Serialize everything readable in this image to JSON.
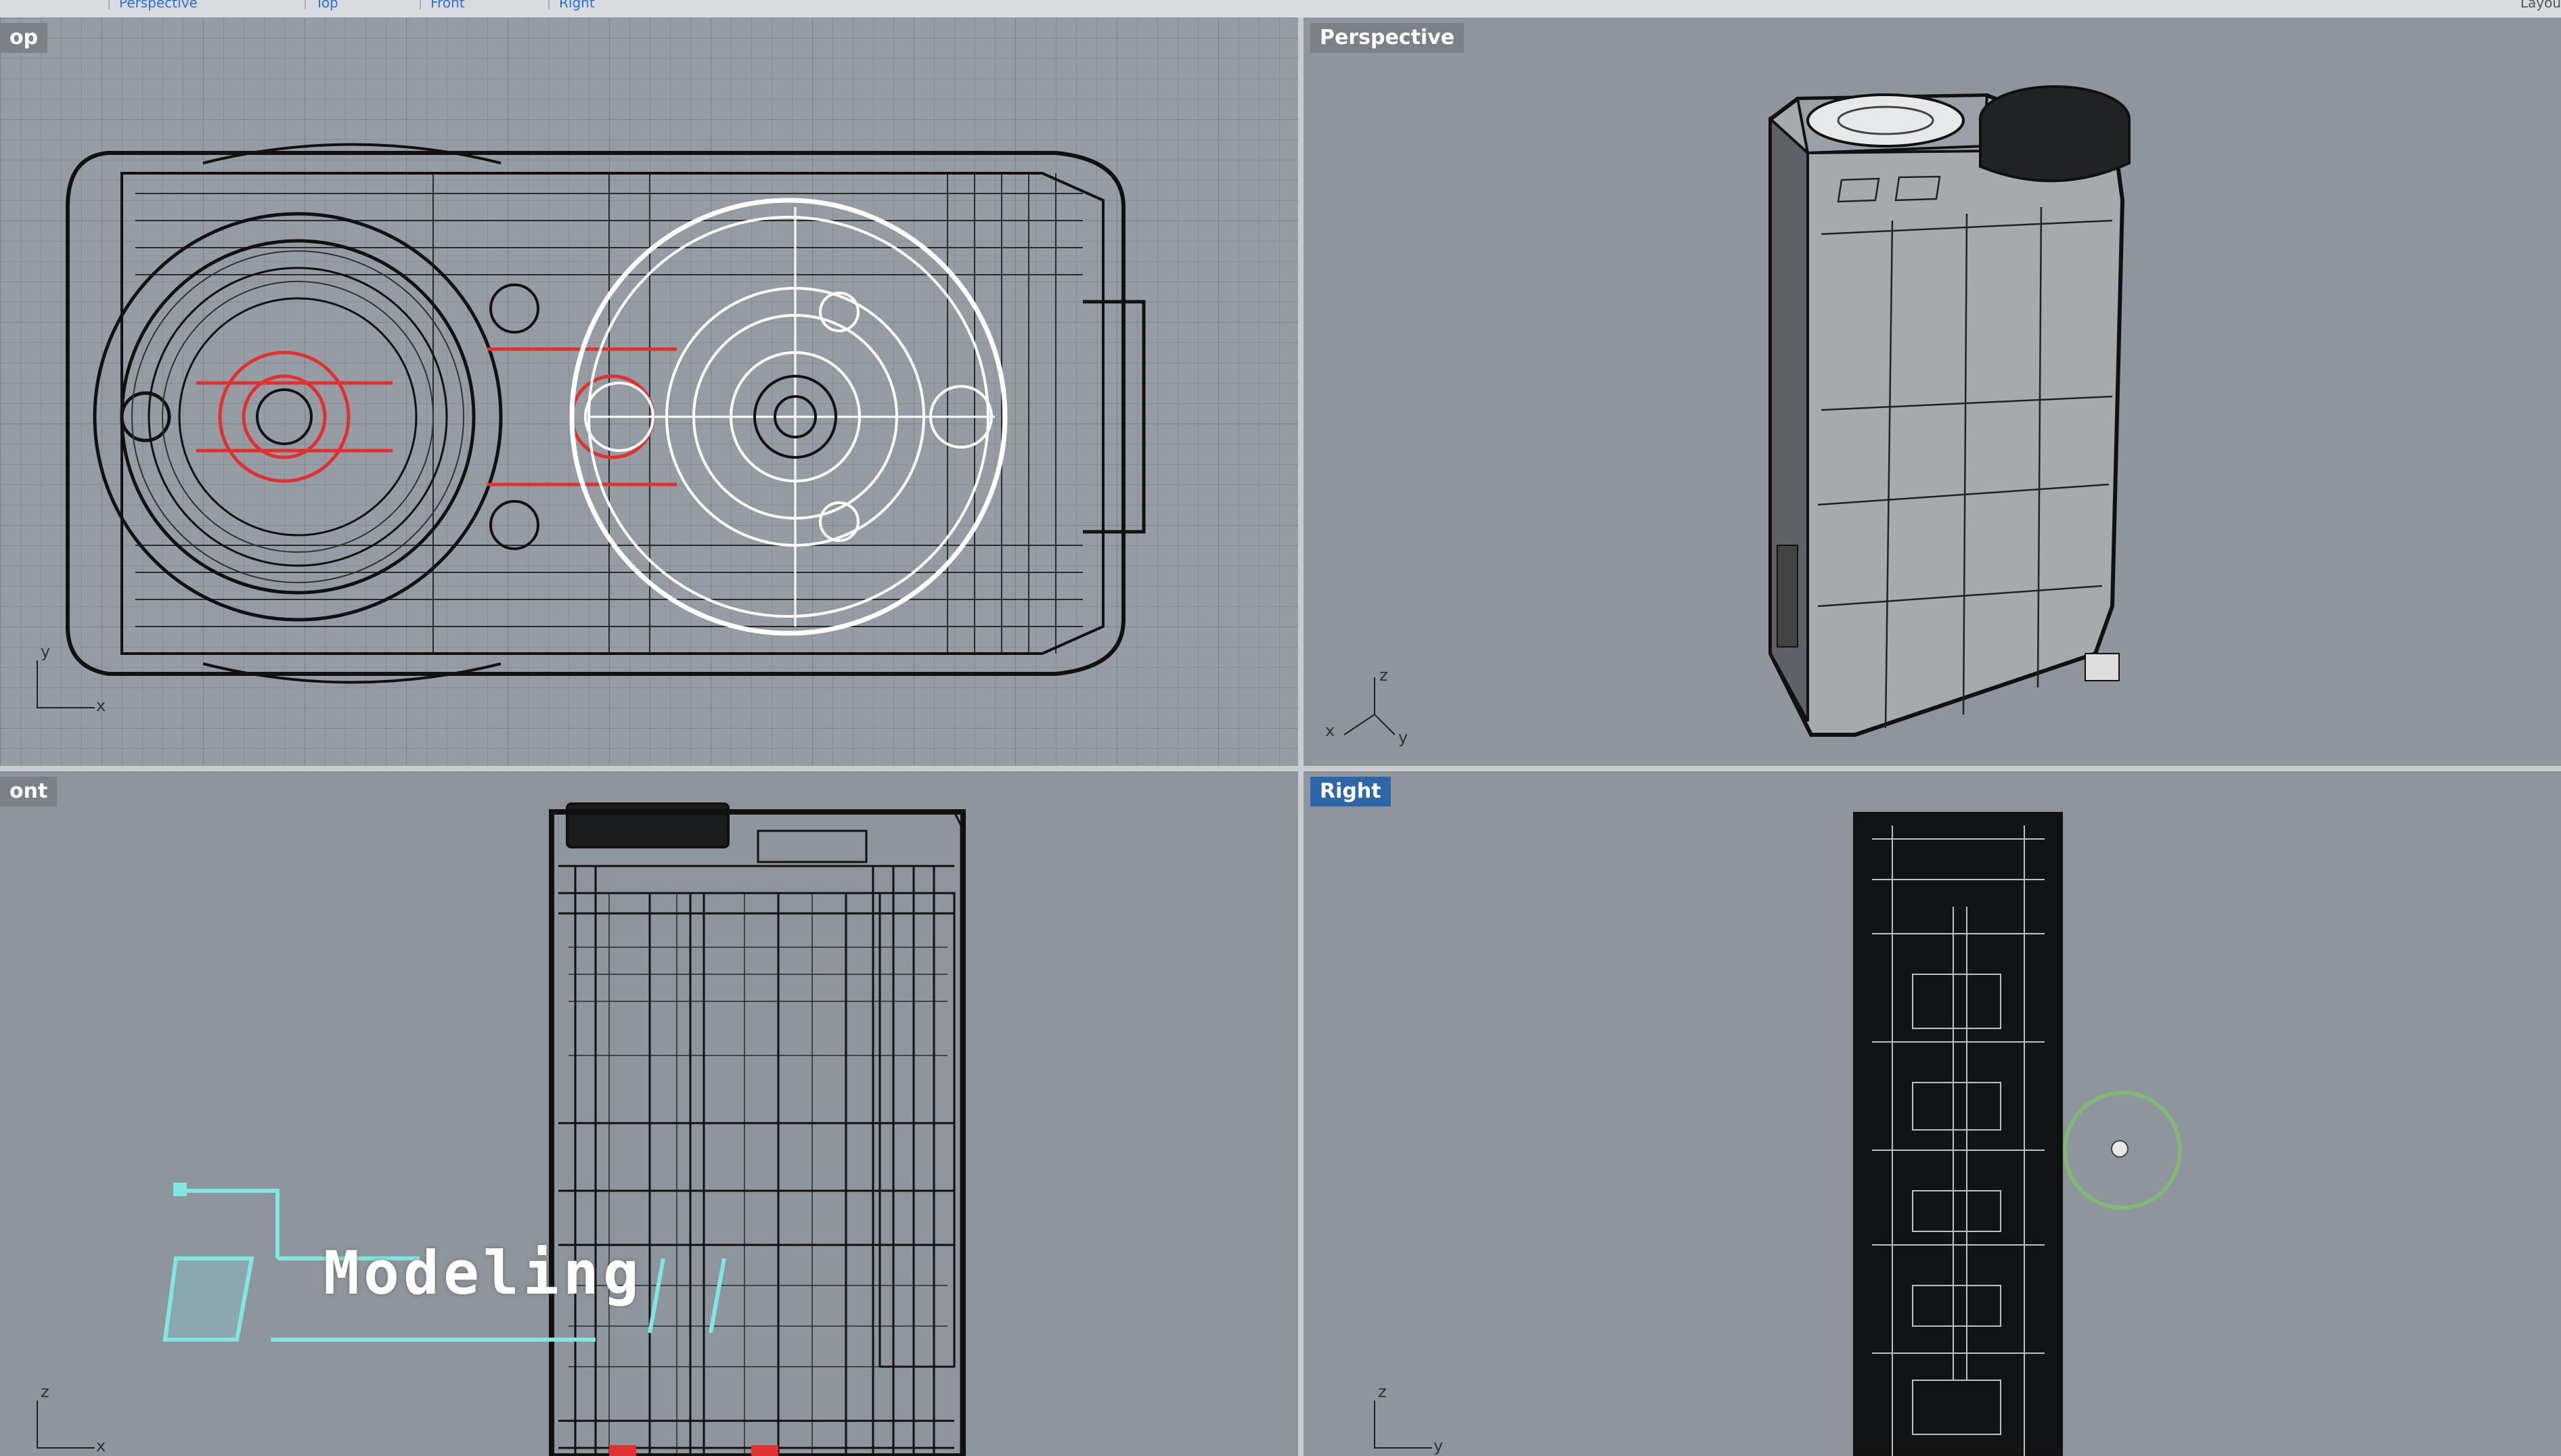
{
  "app": {
    "tabs": [
      "Perspective",
      "Top",
      "Front",
      "Right"
    ],
    "corner_text": "Layou"
  },
  "viewports": {
    "top": {
      "label": "op"
    },
    "perspective": {
      "label": "Perspective"
    },
    "front": {
      "label": "ont"
    },
    "right": {
      "label": "Right",
      "active": true
    }
  },
  "axes": {
    "top": [
      "y",
      "x"
    ],
    "perspective": [
      "z",
      "x",
      "y"
    ],
    "front": [
      "z",
      "x"
    ],
    "right": [
      "z",
      "y"
    ]
  },
  "overlay": {
    "title": "Modeling"
  },
  "colors": {
    "viewport_bg": "#8f959c",
    "active_label": "#2d67a8",
    "wire": "#111111",
    "highlight": "#e03030",
    "overlay_accent": "#7fe6e0"
  }
}
